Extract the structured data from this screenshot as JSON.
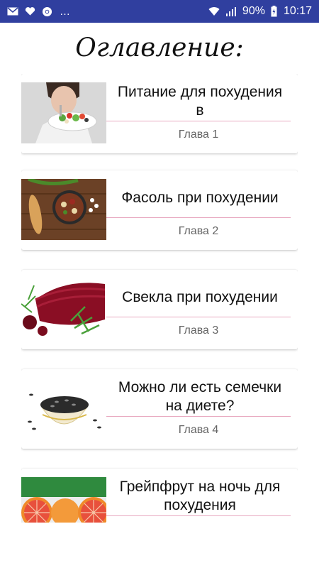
{
  "status_bar": {
    "time": "10:17",
    "battery": "90%",
    "more": "…",
    "icons": [
      "mail-icon",
      "heart-icon",
      "chrome-icon",
      "wifi-icon",
      "signal-icon",
      "battery-icon"
    ]
  },
  "page": {
    "title": "Оглавление:"
  },
  "chapters": [
    {
      "title": "Питание для похудения в",
      "chapter": "Глава 1",
      "image": "woman-eating-salad"
    },
    {
      "title": "Фасоль при похудении",
      "chapter": "Глава 2",
      "image": "bean-dish"
    },
    {
      "title": "Свекла при похудении",
      "chapter": "Глава 3",
      "image": "sliced-beet"
    },
    {
      "title": "Можно ли есть семечки на диете?",
      "chapter": "Глава 4",
      "image": "sunflower-seeds-bowl"
    },
    {
      "title": "Грейпфрут на ночь для похудения",
      "chapter": "",
      "image": "grapefruit-halves"
    }
  ],
  "colors": {
    "status_bar": "#303f9f",
    "divider": "#e8a9c0"
  }
}
